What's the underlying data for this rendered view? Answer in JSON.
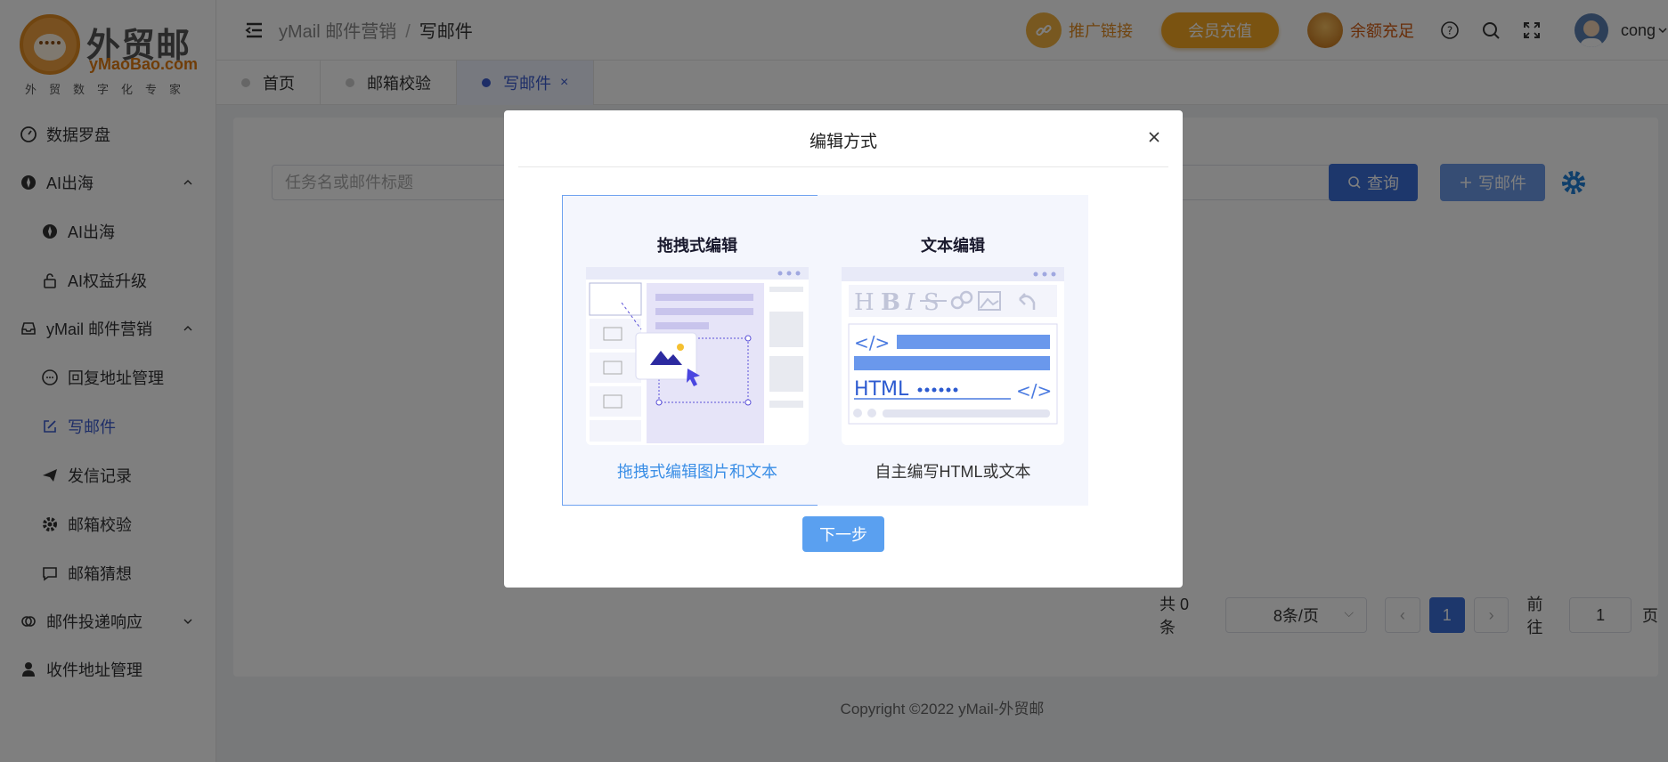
{
  "logo": {
    "cn": "外贸邮",
    "en": "yMaoBao.com",
    "sub": "外贸数字化专家"
  },
  "sidebar": {
    "items": [
      {
        "label": "数据罗盘"
      },
      {
        "label": "AI出海"
      },
      {
        "label": "AI出海"
      },
      {
        "label": "AI权益升级"
      },
      {
        "label": "yMail 邮件营销"
      },
      {
        "label": "回复地址管理"
      },
      {
        "label": "写邮件"
      },
      {
        "label": "发信记录"
      },
      {
        "label": "邮箱校验"
      },
      {
        "label": "邮箱猜想"
      },
      {
        "label": "邮件投递响应"
      },
      {
        "label": "收件地址管理"
      }
    ]
  },
  "header": {
    "breadcrumb": [
      "yMail 邮件营销",
      "写邮件"
    ],
    "separator": "/",
    "promo_link": "推广链接",
    "vip_recharge": "会员充值",
    "balance": "余额充足",
    "username": "cong"
  },
  "tabs": [
    {
      "label": "首页"
    },
    {
      "label": "邮箱校验"
    },
    {
      "label": "写邮件"
    }
  ],
  "tab_close": "×",
  "main": {
    "search_placeholder": "任务名或邮件标题",
    "query_button": "查询",
    "write_button": "写邮件"
  },
  "pagination": {
    "total": "共 0 条",
    "page_size": "8条/页",
    "prev": "‹",
    "current_page": "1",
    "next": "›",
    "goto_label": "前往",
    "goto_value": "1",
    "page_suffix": "页"
  },
  "footer": {
    "copyright": "Copyright ©2022 yMail-外贸邮"
  },
  "modal": {
    "title": "编辑方式",
    "option_drag": {
      "title": "拖拽式编辑",
      "desc": "拖拽式编辑图片和文本"
    },
    "option_text": {
      "title": "文本编辑",
      "desc": "自主编写HTML或文本"
    },
    "next_button": "下一步",
    "illus_html": "HTML",
    "illus_code": "</>"
  },
  "colors": {
    "accent": "#3a5bcf",
    "primary": "#3a6fd8",
    "orange": "#f5a623",
    "selected_border": "#6ea2f0"
  }
}
